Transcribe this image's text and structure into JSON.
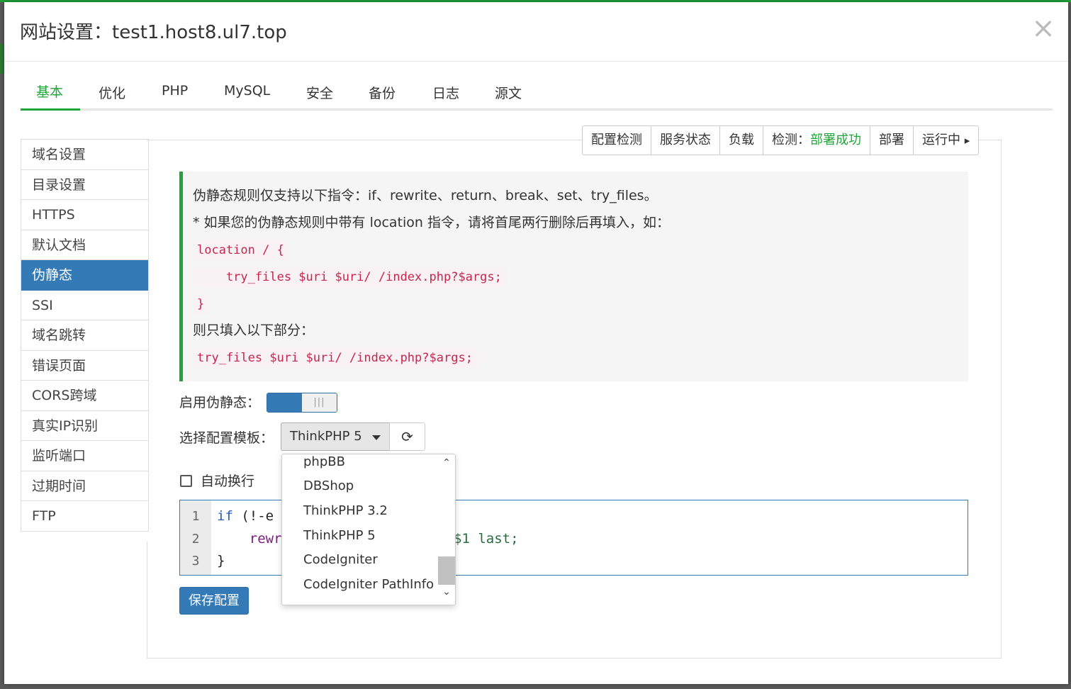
{
  "dialog": {
    "title": "网站设置：test1.host8.ul7.top",
    "close_glyph": "×"
  },
  "tabs": [
    {
      "label": "基本",
      "active": true
    },
    {
      "label": "优化"
    },
    {
      "label": "PHP"
    },
    {
      "label": "MySQL"
    },
    {
      "label": "安全"
    },
    {
      "label": "备份"
    },
    {
      "label": "日志"
    },
    {
      "label": "源文"
    }
  ],
  "sidebar": {
    "items": [
      {
        "label": "域名设置"
      },
      {
        "label": "目录设置"
      },
      {
        "label": "HTTPS"
      },
      {
        "label": "默认文档"
      },
      {
        "label": "伪静态",
        "active": true
      },
      {
        "label": "SSI"
      },
      {
        "label": "域名跳转"
      },
      {
        "label": "错误页面"
      },
      {
        "label": "CORS跨域"
      },
      {
        "label": "真实IP识别"
      },
      {
        "label": "监听端口"
      },
      {
        "label": "过期时间"
      },
      {
        "label": "FTP"
      }
    ]
  },
  "status_bar": {
    "config_check": "配置检测",
    "service_status": "服务状态",
    "load": "负载",
    "detect_label": "检测：",
    "detect_value": "部署成功",
    "deploy": "部署",
    "running": "运行中",
    "running_icon": "caret-right-icon",
    "running_glyph": "▸"
  },
  "tips": {
    "line1": "伪静态规则仅支持以下指令：if、rewrite、return、break、set、try_files。",
    "line2": "* 如果您的伪静态规则中带有 location 指令，请将首尾两行删除后再填入，如：",
    "code1": "location / {",
    "code2": "    try_files $uri $uri/ /index.php?$args;",
    "code3": "}",
    "line3": "则只填入以下部分：",
    "code4": "try_files $uri $uri/ /index.php?$args;"
  },
  "rewrite": {
    "enable_label": "启用伪静态：",
    "enabled": true,
    "template_label": "选择配置模板：",
    "selected_template": "ThinkPHP 5",
    "refresh_icon": "refresh-icon",
    "refresh_glyph": "⟳",
    "options_visible": [
      "phpBB",
      "DBShop",
      "ThinkPHP 3.2",
      "ThinkPHP 5",
      "CodeIgniter",
      "CodeIgniter PathInfo"
    ],
    "scroll_up_glyph": "⌃",
    "scroll_down_glyph": "⌄",
    "auto_wrap_label": "自动换行",
    "auto_wrap_checked": false
  },
  "editor": {
    "line_numbers": [
      "1",
      "2",
      "3"
    ],
    "line1_kw": "if",
    "line1_rest": " (!-e",
    "line2_fn": "    rewr",
    "line2_tail_var": "$1",
    "line2_tail_rest": " last;",
    "line3": "}"
  },
  "save_button": "保存配置",
  "colors": {
    "accent_green": "#20a53a",
    "primary_blue": "#337ab7",
    "code_red": "#c7254e"
  }
}
